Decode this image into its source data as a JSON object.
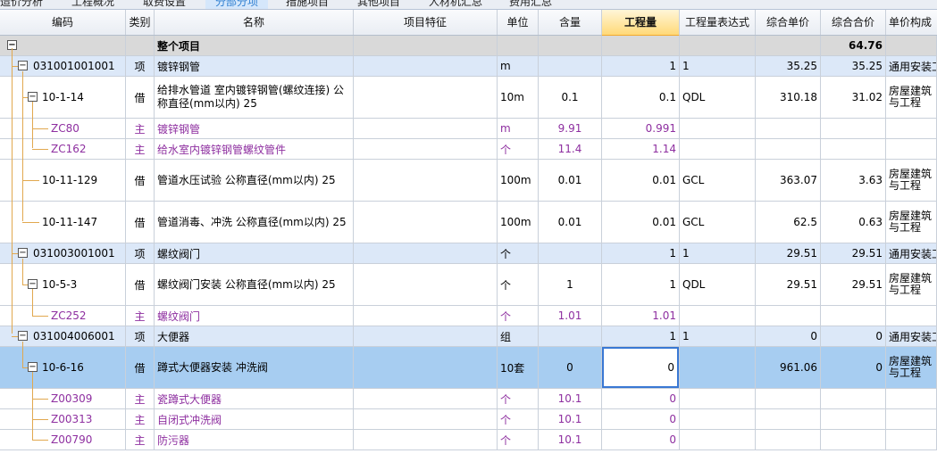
{
  "tabs": [
    {
      "label": "造价分析",
      "active": false
    },
    {
      "label": "工程概况",
      "active": false
    },
    {
      "label": "取费设置",
      "active": false
    },
    {
      "label": "分部分项",
      "active": true
    },
    {
      "label": "措施项目",
      "active": false
    },
    {
      "label": "其他项目",
      "active": false
    },
    {
      "label": "人材机汇总",
      "active": false
    },
    {
      "label": "费用汇总",
      "active": false
    }
  ],
  "columns": {
    "code": "编码",
    "type": "类别",
    "name": "名称",
    "feature": "项目特征",
    "unit": "单位",
    "content": "含量",
    "qty": "工程量",
    "expr": "工程量表达式",
    "price": "综合单价",
    "total": "综合合价",
    "comp": "单价构成"
  },
  "icons": {
    "minus": "−"
  },
  "rows": [
    {
      "code": "",
      "type": "",
      "name": "整个项目",
      "unit": "",
      "content": "",
      "qty": "",
      "expr": "",
      "price": "",
      "total": "64.76",
      "comp": ""
    },
    {
      "code": "031001001001",
      "type": "项",
      "name": "镀锌钢管",
      "unit": "m",
      "content": "",
      "qty": "1",
      "expr": "1",
      "price": "35.25",
      "total": "35.25",
      "comp": "通用安装工"
    },
    {
      "code": "10-1-14",
      "type": "借",
      "name": "给排水管道 室内镀锌钢管(螺纹连接) 公称直径(mm以内) 25",
      "unit": "10m",
      "content": "0.1",
      "qty": "0.1",
      "expr": "QDL",
      "price": "310.18",
      "total": "31.02",
      "comp": "房屋建筑与工程"
    },
    {
      "code": "ZC80",
      "type": "主",
      "name": "镀锌钢管",
      "unit": "m",
      "content": "9.91",
      "qty": "0.991",
      "expr": "",
      "price": "",
      "total": "",
      "comp": ""
    },
    {
      "code": "ZC162",
      "type": "主",
      "name": "给水室内镀锌钢管螺纹管件",
      "unit": "个",
      "content": "11.4",
      "qty": "1.14",
      "expr": "",
      "price": "",
      "total": "",
      "comp": ""
    },
    {
      "code": "10-11-129",
      "type": "借",
      "name": "管道水压试验 公称直径(mm以内) 25",
      "unit": "100m",
      "content": "0.01",
      "qty": "0.01",
      "expr": "GCL",
      "price": "363.07",
      "total": "3.63",
      "comp": "房屋建筑与工程"
    },
    {
      "code": "10-11-147",
      "type": "借",
      "name": "管道消毒、冲洗 公称直径(mm以内) 25",
      "unit": "100m",
      "content": "0.01",
      "qty": "0.01",
      "expr": "GCL",
      "price": "62.5",
      "total": "0.63",
      "comp": "房屋建筑与工程"
    },
    {
      "code": "031003001001",
      "type": "项",
      "name": "螺纹阀门",
      "unit": "个",
      "content": "",
      "qty": "1",
      "expr": "1",
      "price": "29.51",
      "total": "29.51",
      "comp": "通用安装工"
    },
    {
      "code": "10-5-3",
      "type": "借",
      "name": "螺纹阀门安装 公称直径(mm以内) 25",
      "unit": "个",
      "content": "1",
      "qty": "1",
      "expr": "QDL",
      "price": "29.51",
      "total": "29.51",
      "comp": "房屋建筑与工程"
    },
    {
      "code": "ZC252",
      "type": "主",
      "name": "螺纹阀门",
      "unit": "个",
      "content": "1.01",
      "qty": "1.01",
      "expr": "",
      "price": "",
      "total": "",
      "comp": ""
    },
    {
      "code": "031004006001",
      "type": "项",
      "name": "大便器",
      "unit": "组",
      "content": "",
      "qty": "1",
      "expr": "1",
      "price": "0",
      "total": "0",
      "comp": "通用安装工"
    },
    {
      "code": "10-6-16",
      "type": "借",
      "name": "蹲式大便器安装 冲洗阀",
      "unit": "10套",
      "content": "0",
      "qty": "0",
      "expr": "",
      "price": "961.06",
      "total": "0",
      "comp": "房屋建筑与工程"
    },
    {
      "code": "Z00309",
      "type": "主",
      "name": "瓷蹲式大便器",
      "unit": "个",
      "content": "10.1",
      "qty": "0",
      "expr": "",
      "price": "",
      "total": "",
      "comp": ""
    },
    {
      "code": "Z00313",
      "type": "主",
      "name": "自闭式冲洗阀",
      "unit": "个",
      "content": "10.1",
      "qty": "0",
      "expr": "",
      "price": "",
      "total": "",
      "comp": ""
    },
    {
      "code": "Z00790",
      "type": "主",
      "name": "防污器",
      "unit": "个",
      "content": "10.1",
      "qty": "0",
      "expr": "",
      "price": "",
      "total": "",
      "comp": ""
    }
  ]
}
